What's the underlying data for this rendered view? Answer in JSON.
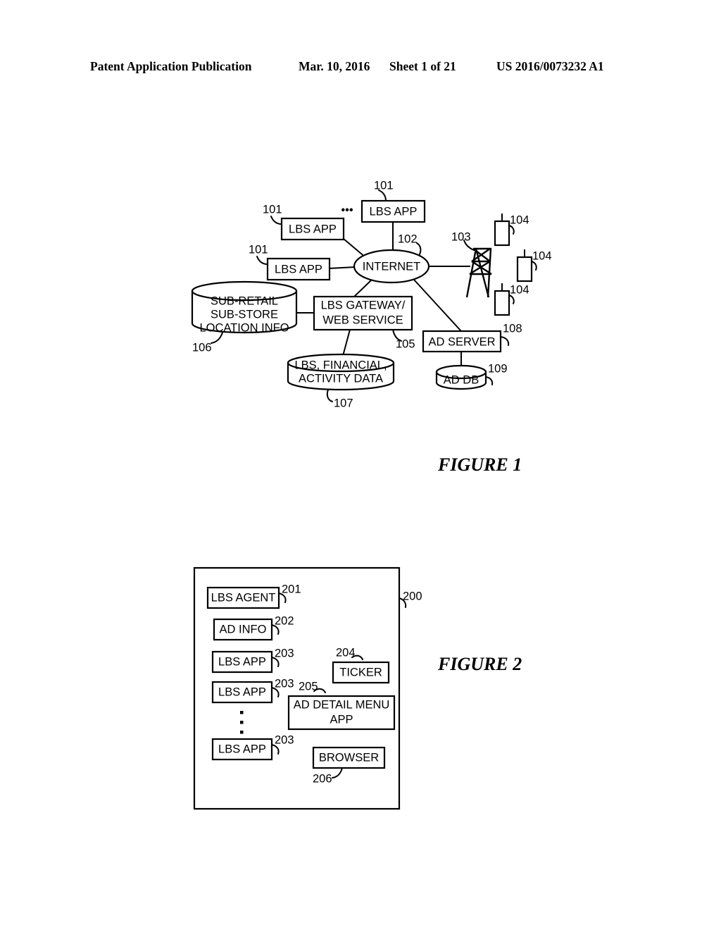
{
  "header": {
    "publication": "Patent Application Publication",
    "date": "Mar. 10, 2016",
    "sheet": "Sheet 1 of 21",
    "patent_number": "US 2016/0073232 A1"
  },
  "figure1": {
    "caption": "FIGURE 1",
    "nodes": {
      "lbs_app_top": "LBS APP",
      "lbs_app_mid": "LBS APP",
      "lbs_app_low": "LBS APP",
      "internet": "INTERNET",
      "sub_retail_db": "SUB-RETAIL SUB-STORE LOCATION INFO",
      "sub_retail_line1": "SUB-RETAIL",
      "sub_retail_line2": "SUB-STORE",
      "sub_retail_line3": "LOCATION INFO",
      "lbs_gateway_line1": "LBS GATEWAY/",
      "lbs_gateway_line2": "WEB SERVICE",
      "activity_db_line1": "LBS, FINANCIAL,",
      "activity_db_line2": "ACTIVITY DATA",
      "ad_server": "AD SERVER",
      "ad_db": "AD DB"
    },
    "refs": {
      "lbs_app_top": "101",
      "lbs_app_mid": "101",
      "lbs_app_low": "101",
      "internet": "102",
      "cell_tower": "103",
      "mobile_1": "104",
      "mobile_2": "104",
      "mobile_3": "104",
      "lbs_gateway": "105",
      "sub_retail_db": "106",
      "activity_db": "107",
      "ad_server": "108",
      "ad_db": "109"
    },
    "ellipsis": "•••"
  },
  "figure2": {
    "caption": "FIGURE 2",
    "nodes": {
      "lbs_agent": "LBS AGENT",
      "ad_info": "AD INFO",
      "lbs_app_1": "LBS APP",
      "lbs_app_2": "LBS APP",
      "lbs_app_n": "LBS APP",
      "ticker": "TICKER",
      "ad_detail_menu_line1": "AD DETAIL MENU",
      "ad_detail_menu_line2": "APP",
      "browser": "BROWSER"
    },
    "refs": {
      "device": "200",
      "lbs_agent": "201",
      "ad_info": "202",
      "lbs_app_1": "203",
      "lbs_app_2": "203",
      "lbs_app_n": "203",
      "ticker": "204",
      "ad_detail_menu": "205",
      "browser": "206"
    }
  },
  "colors": {
    "ink": "#000000",
    "paper": "#ffffff"
  }
}
